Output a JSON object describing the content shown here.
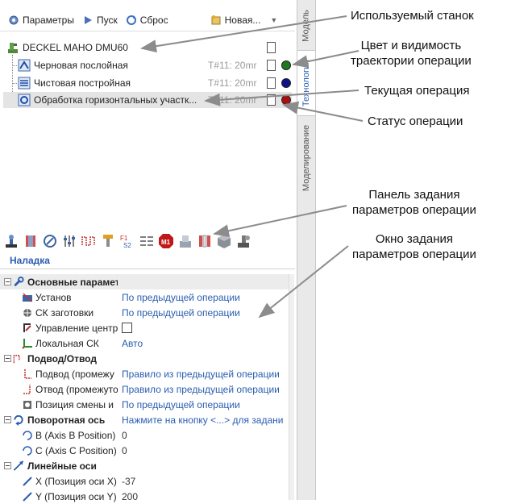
{
  "toolbar": {
    "params_label": "Параметры",
    "run_label": "Пуск",
    "reset_label": "Сброс",
    "new_label": "Новая..."
  },
  "vtabs": [
    "Модель",
    "Технология",
    "Моделирование"
  ],
  "machine": "DECKEL MAHO DMU60",
  "operations": [
    {
      "label": "Черновая послойная",
      "tool": "T#11: 20mr",
      "color": "#1f7a1f"
    },
    {
      "label": "Чистовая постройная",
      "tool": "T#11: 20mr",
      "color": "#10108a"
    },
    {
      "label": "Обработка горизонтальных участк...",
      "tool": "T#11: 20mr",
      "color": "#a81010"
    }
  ],
  "params_tab": "Наладка",
  "params": [
    {
      "name": "Основные парамет",
      "value": "",
      "group": true
    },
    {
      "name": "Установ",
      "value": "По предыдущей операции",
      "link": true
    },
    {
      "name": "СК заготовки",
      "value": "По предыдущей операции",
      "link": true
    },
    {
      "name": "Управление центр",
      "value": "",
      "checkbox": true
    },
    {
      "name": "Локальная СК",
      "value": "Авто",
      "link": true
    },
    {
      "name": "Подвод/Отвод",
      "value": "",
      "group": true
    },
    {
      "name": "Подвод (промежу",
      "value": "Правило из предыдущей операции",
      "link": true
    },
    {
      "name": "Отвод (промежуто",
      "value": "Правило из предыдущей операции",
      "link": true
    },
    {
      "name": "Позиция смены и",
      "value": "По предыдущей операции",
      "link": true
    },
    {
      "name": "Поворотная ось",
      "value": "Нажмите на кнопку <...> для задани",
      "group": true,
      "link": true
    },
    {
      "name": "B (Axis B Position)",
      "value": "0"
    },
    {
      "name": "C (Axis C Position)",
      "value": "0"
    },
    {
      "name": "Линейные оси",
      "value": "",
      "group": true
    },
    {
      "name": "X (Позиция оси X)",
      "value": "-37"
    },
    {
      "name": "Y (Позиция оси Y)",
      "value": "200"
    }
  ],
  "annotations": {
    "machine": "Используемый станок",
    "color": "Цвет и видимость\nтраектории операции",
    "current": "Текущая операция",
    "status": "Статус операции",
    "panel": "Панель задания\nпараметров операции",
    "window": "Окно задания\nпараметров операции"
  }
}
